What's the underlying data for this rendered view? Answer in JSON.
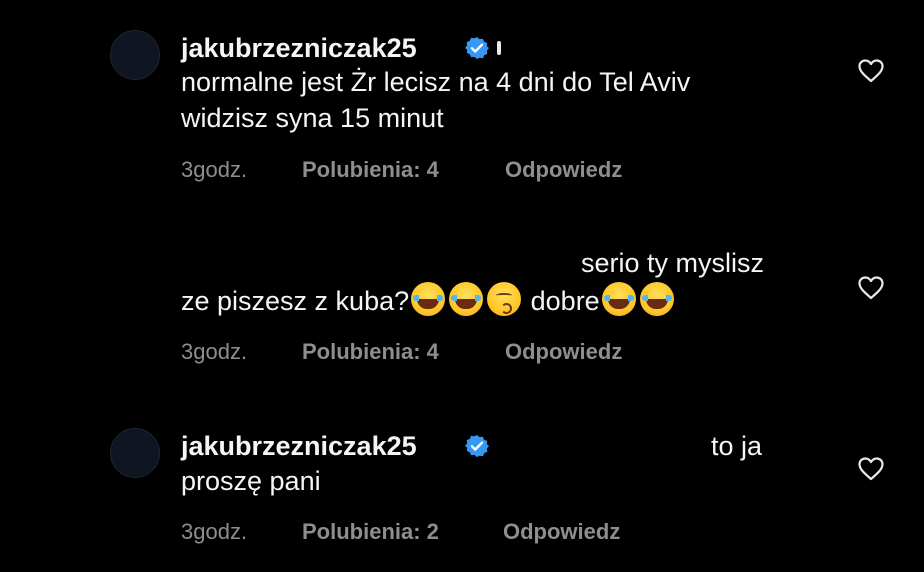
{
  "comments": [
    {
      "username": "jakubrzezniczak25",
      "verified": true,
      "lines": [
        "normalne jest Żr lecisz na 4 dni do Tel Aviv",
        "widzisz syna 15 minut"
      ],
      "time": "3godz.",
      "likes": "Polubienia: 4",
      "reply": "Odpowiedz"
    },
    {
      "line1": "serio ty myslisz",
      "line2_start": "ze piszesz z kuba?",
      "line2_mid": "dobre",
      "time": "3godz.",
      "likes": "Polubienia: 4",
      "reply": "Odpowiedz"
    },
    {
      "username": "jakubrzezniczak25",
      "verified": true,
      "line1": "to ja",
      "line2": "proszę pani",
      "time": "3godz.",
      "likes": "Polubienia: 2",
      "reply": "Odpowiedz"
    }
  ],
  "icons": {
    "verified": "verified-badge-icon",
    "heart": "heart-outline-icon",
    "emoji_laugh": "face-with-tears-of-joy-icon",
    "emoji_kiss": "kissing-face-icon"
  },
  "colors": {
    "background": "#000000",
    "text": "#f5f5f5",
    "muted": "#8e8e8e",
    "verified": "#3897f0"
  }
}
